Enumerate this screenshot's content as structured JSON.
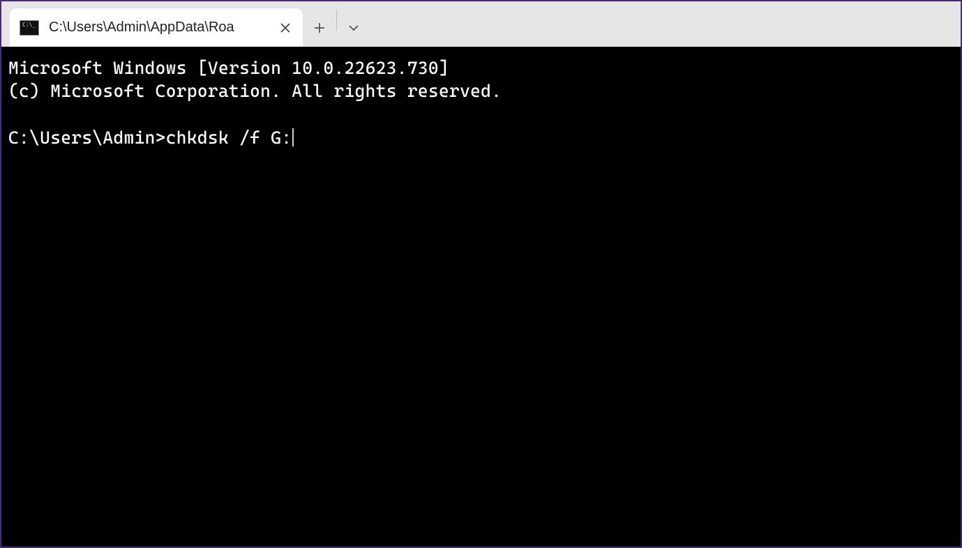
{
  "tab": {
    "title": "C:\\Users\\Admin\\AppData\\Roa"
  },
  "terminal": {
    "banner_line1": "Microsoft Windows [Version 10.0.22623.730]",
    "banner_line2": "(c) Microsoft Corporation. All rights reserved.",
    "prompt": "C:\\Users\\Admin>",
    "command": "chkdsk /f G:"
  }
}
